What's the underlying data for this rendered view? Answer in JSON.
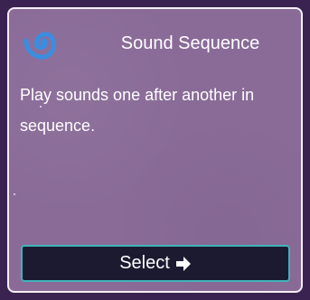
{
  "card": {
    "title": "Sound Sequence",
    "description": "Play sounds one after another in sequence.",
    "icon": "spiral-icon",
    "select_label": "Select",
    "select_icon": "arrow-right-icon"
  },
  "colors": {
    "card_bg": "#8a6b98",
    "card_border": "#f2eef5",
    "icon": "#3b8de0",
    "button_bg": "#1c1a30",
    "button_border": "#3fb3b8"
  }
}
